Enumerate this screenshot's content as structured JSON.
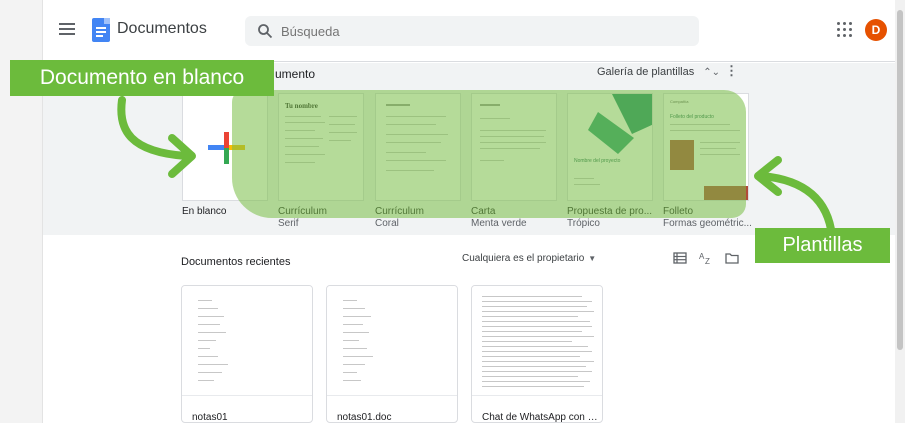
{
  "header": {
    "app_title": "Documentos",
    "search_placeholder": "Búsqueda",
    "avatar_letter": "D",
    "avatar_color": "#e65100",
    "icons": [
      "menu-icon",
      "docs-logo-icon",
      "search-icon",
      "apps-grid-icon"
    ]
  },
  "templates": {
    "heading": "umento",
    "gallery_label": "Galería de plantillas",
    "items": [
      {
        "name": "En blanco",
        "subtitle": ""
      },
      {
        "name": "Currículum",
        "subtitle": "Serif"
      },
      {
        "name": "Currículum",
        "subtitle": "Coral"
      },
      {
        "name": "Carta",
        "subtitle": "Menta verde"
      },
      {
        "name": "Propuesta de pro...",
        "subtitle": "Trópico"
      },
      {
        "name": "Folleto",
        "subtitle": "Formas geométric..."
      }
    ],
    "thumb_texts": {
      "serif_title": "Tu nombre",
      "project_title": "Nombre del proyecto",
      "folleto_header": "Compañía",
      "folleto_title": "Folleto del producto"
    }
  },
  "recent": {
    "title": "Documentos recientes",
    "owner_filter": "Cualquiera es el propietario",
    "docs": [
      {
        "title": "notas01"
      },
      {
        "title": "notas01.doc"
      },
      {
        "title": "Chat de WhatsApp con D..."
      }
    ]
  },
  "annotations": {
    "blank_label": "Documento en blanco",
    "templates_label": "Plantillas",
    "accent_color": "#6cbb3c"
  }
}
